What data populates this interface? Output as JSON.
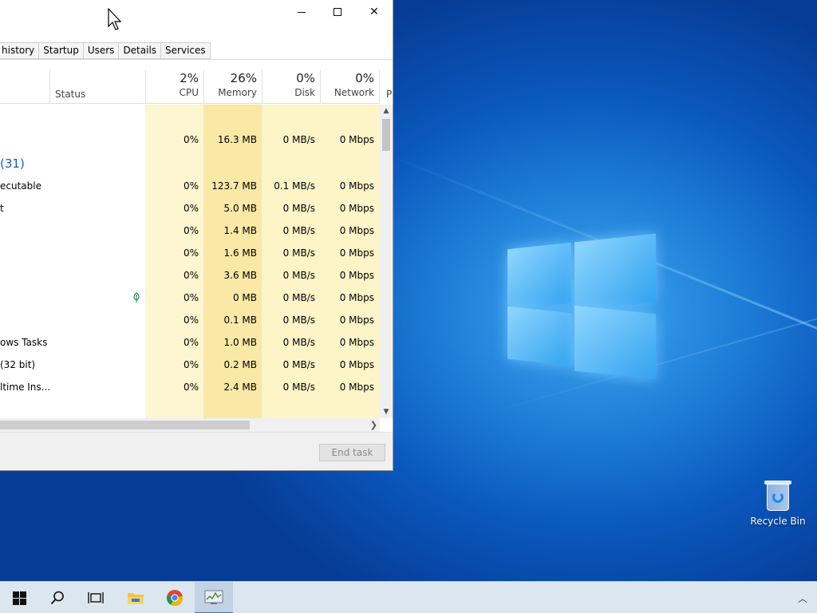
{
  "window": {
    "minimize": "",
    "maximize": "",
    "close": "✕"
  },
  "tabs": [
    {
      "label": "history"
    },
    {
      "label": "Startup"
    },
    {
      "label": "Users"
    },
    {
      "label": "Details"
    },
    {
      "label": "Services"
    }
  ],
  "columns": {
    "status": "Status",
    "cpu": {
      "pct": "2%",
      "label": "CPU"
    },
    "memory": {
      "pct": "26%",
      "label": "Memory"
    },
    "disk": {
      "pct": "0%",
      "label": "Disk"
    },
    "network": {
      "pct": "0%",
      "label": "Network"
    },
    "p": "P"
  },
  "rows": [
    {
      "name": "",
      "cpu": "",
      "memory": "",
      "disk": "",
      "network": ""
    },
    {
      "name": "",
      "cpu": "0%",
      "memory": "16.3 MB",
      "disk": "0 MB/s",
      "network": "0 Mbps"
    },
    {
      "name": "(31)",
      "cpu": "",
      "memory": "",
      "disk": "",
      "network": "",
      "group": true
    },
    {
      "name": "ecutable",
      "cpu": "0%",
      "memory": "123.7 MB",
      "disk": "0.1 MB/s",
      "network": "0 Mbps"
    },
    {
      "name": "t",
      "cpu": "0%",
      "memory": "5.0 MB",
      "disk": "0 MB/s",
      "network": "0 Mbps"
    },
    {
      "name": "",
      "cpu": "0%",
      "memory": "1.4 MB",
      "disk": "0 MB/s",
      "network": "0 Mbps"
    },
    {
      "name": "",
      "cpu": "0%",
      "memory": "1.6 MB",
      "disk": "0 MB/s",
      "network": "0 Mbps"
    },
    {
      "name": "",
      "cpu": "0%",
      "memory": "3.6 MB",
      "disk": "0 MB/s",
      "network": "0 Mbps"
    },
    {
      "name": "",
      "cpu": "0%",
      "memory": "0 MB",
      "disk": "0 MB/s",
      "network": "0 Mbps",
      "leaf": true
    },
    {
      "name": "",
      "cpu": "0%",
      "memory": "0.1 MB",
      "disk": "0 MB/s",
      "network": "0 Mbps"
    },
    {
      "name": "ows Tasks",
      "cpu": "0%",
      "memory": "1.0 MB",
      "disk": "0 MB/s",
      "network": "0 Mbps"
    },
    {
      "name": "(32 bit)",
      "cpu": "0%",
      "memory": "0.2 MB",
      "disk": "0 MB/s",
      "network": "0 Mbps"
    },
    {
      "name": "ltime Ins...",
      "cpu": "0%",
      "memory": "2.4 MB",
      "disk": "0 MB/s",
      "network": "0 Mbps"
    }
  ],
  "footer": {
    "end_task": "End task"
  },
  "desktop": {
    "recycle_bin": "Recycle Bin"
  },
  "colors": {
    "heat_light": "#fdf6d0",
    "heat_mid": "#fbeeb2",
    "heat_strong": "#f8e49a",
    "accent": "#1e5bb8"
  },
  "taskbar": {
    "icons": [
      "windows-start-icon",
      "search-icon",
      "task-view-icon",
      "file-explorer-icon",
      "chrome-icon",
      "task-manager-icon"
    ]
  }
}
